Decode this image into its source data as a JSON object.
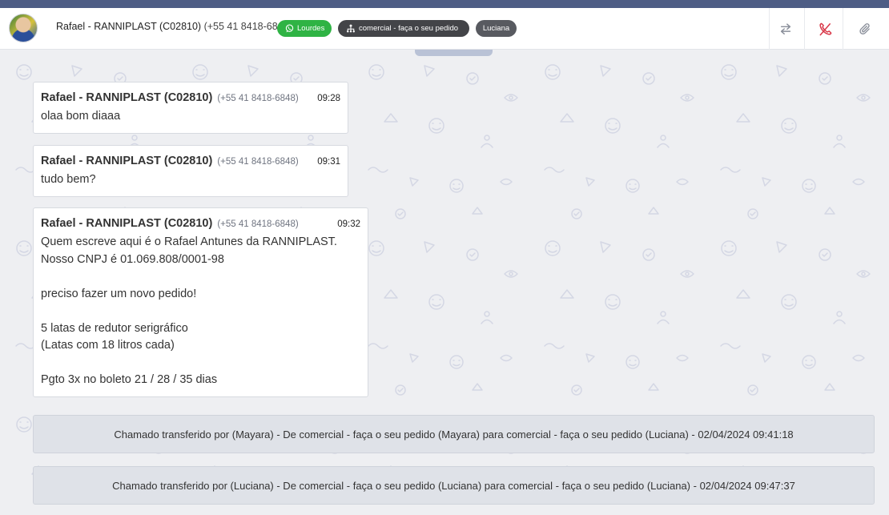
{
  "header": {
    "contact_name": "Rafael - RANNIPLAST (C02810)",
    "contact_phone": "(+55 41 8418-6848)",
    "tags": {
      "channel_agent": "Lourdes",
      "department": "comercial - faça o seu pedido",
      "current_agent": "Luciana"
    },
    "actions": [
      "transfer-icon",
      "hangup-phone-icon",
      "paperclip-icon"
    ]
  },
  "messages": [
    {
      "sender": "Rafael - RANNIPLAST (C02810)",
      "phone": "(+55 41 8418-6848)",
      "time": "09:28",
      "text": "olaa bom diaaa"
    },
    {
      "sender": "Rafael - RANNIPLAST (C02810)",
      "phone": "(+55 41 8418-6848)",
      "time": "09:31",
      "text": "tudo bem?"
    },
    {
      "sender": "Rafael - RANNIPLAST (C02810)",
      "phone": "(+55 41 8418-6848)",
      "time": "09:32",
      "text": "Quem escreve aqui é o Rafael Antunes da RANNIPLAST.\nNosso CNPJ é 01.069.808/0001-98\n\npreciso fazer um novo pedido!\n\n5 latas de redutor serigráfico\n(Latas com 18 litros cada)\n\nPgto 3x no boleto 21 / 28 / 35 dias"
    }
  ],
  "system_messages": [
    "Chamado transferido por (Mayara) - De comercial - faça o seu pedido (Mayara) para comercial - faça o seu pedido (Luciana) - 02/04/2024 09:41:18",
    "Chamado transferido por (Luciana) - De comercial - faça o seu pedido (Luciana) para comercial - faça o seu pedido (Luciana) - 02/04/2024 09:47:37"
  ],
  "colors": {
    "top_strip": "#4e5d85",
    "whatsapp_tag": "#2fb344",
    "department_tag": "#434448",
    "agent_tag": "#585a60",
    "hangup_icon": "#d93a4a",
    "chat_background": "#eeeff2"
  }
}
